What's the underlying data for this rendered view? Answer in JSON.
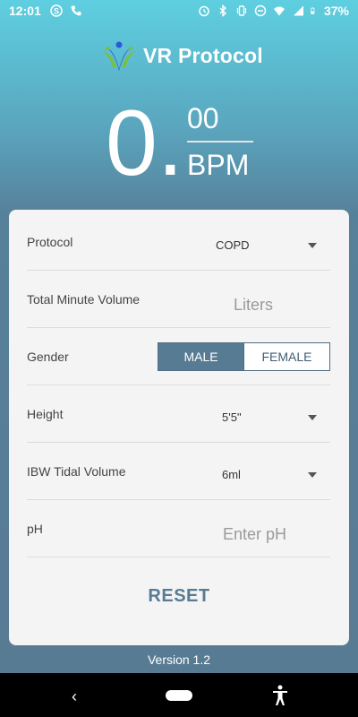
{
  "status_bar": {
    "time": "12:01",
    "battery": "37%",
    "icons_left": [
      "skype-icon",
      "phone-icon"
    ],
    "icons_right": [
      "alarm-icon",
      "bluetooth-icon",
      "vibrate-icon",
      "dnd-icon",
      "wifi-icon",
      "signal-icon",
      "battery-icon"
    ]
  },
  "header": {
    "app_title": "VR Protocol"
  },
  "bpm": {
    "integer": "0.",
    "decimal": "00",
    "unit": "BPM"
  },
  "form": {
    "protocol": {
      "label": "Protocol",
      "value": "COPD"
    },
    "minute_volume": {
      "label": "Total Minute Volume",
      "placeholder": "Liters"
    },
    "gender": {
      "label": "Gender",
      "options": [
        "MALE",
        "FEMALE"
      ],
      "selected": "MALE"
    },
    "height": {
      "label": "Height",
      "value": "5'5\""
    },
    "tidal_volume": {
      "label": "IBW Tidal Volume",
      "value": "6ml"
    },
    "ph": {
      "label": "pH",
      "placeholder": "Enter pH"
    },
    "reset_label": "RESET"
  },
  "footer": {
    "version": "Version 1.2"
  },
  "colors": {
    "accent": "#587b94",
    "gradient_top": "#5ecfe0",
    "card_bg": "#f4f4f4"
  }
}
